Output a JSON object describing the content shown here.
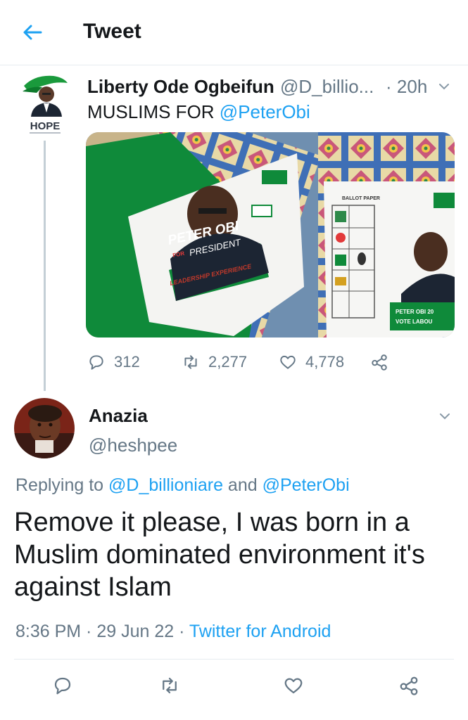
{
  "header": {
    "title": "Tweet",
    "back_icon": "arrow-left-icon"
  },
  "original_tweet": {
    "author_name": "Liberty Ode Ogbeifun",
    "author_handle": "@D_billio...",
    "separator": "·",
    "time": "20h",
    "text_prefix": "MUSLIMS FOR ",
    "text_mention": "@PeterObi",
    "avatar_label": "HOPE",
    "media": {
      "left_mat_name": "PETER OBI",
      "left_mat_for": "FOR",
      "left_mat_office": "PRESIDENT",
      "left_mat_strip": "LEADERSHIP EXPERIENCE",
      "right_mat_heading": "BALLOT PAPER",
      "right_mat_footer_1": "PETER OBI 20",
      "right_mat_footer_2": "VOTE LABOU"
    },
    "counts": {
      "replies": "312",
      "retweets": "2,277",
      "likes": "4,778"
    }
  },
  "reply": {
    "author_name": "Anazia",
    "author_handle": "@heshpee",
    "replying_prefix": "Replying to ",
    "replying_mention_1": "@D_billioniare",
    "replying_and": " and ",
    "replying_mention_2": "@PeterObi",
    "text": "Remove it please, I was born in a Muslim dominated environment it's against Islam",
    "time": "8:36 PM",
    "sep": " · ",
    "date": "29 Jun 22",
    "source": "Twitter for Android"
  },
  "colors": {
    "accent": "#1da1f2",
    "muted": "#657786",
    "text": "#14171a",
    "green": "#0f8a3a"
  },
  "icons": [
    "reply-icon",
    "retweet-icon",
    "like-icon",
    "share-icon",
    "chevron-down-icon"
  ]
}
